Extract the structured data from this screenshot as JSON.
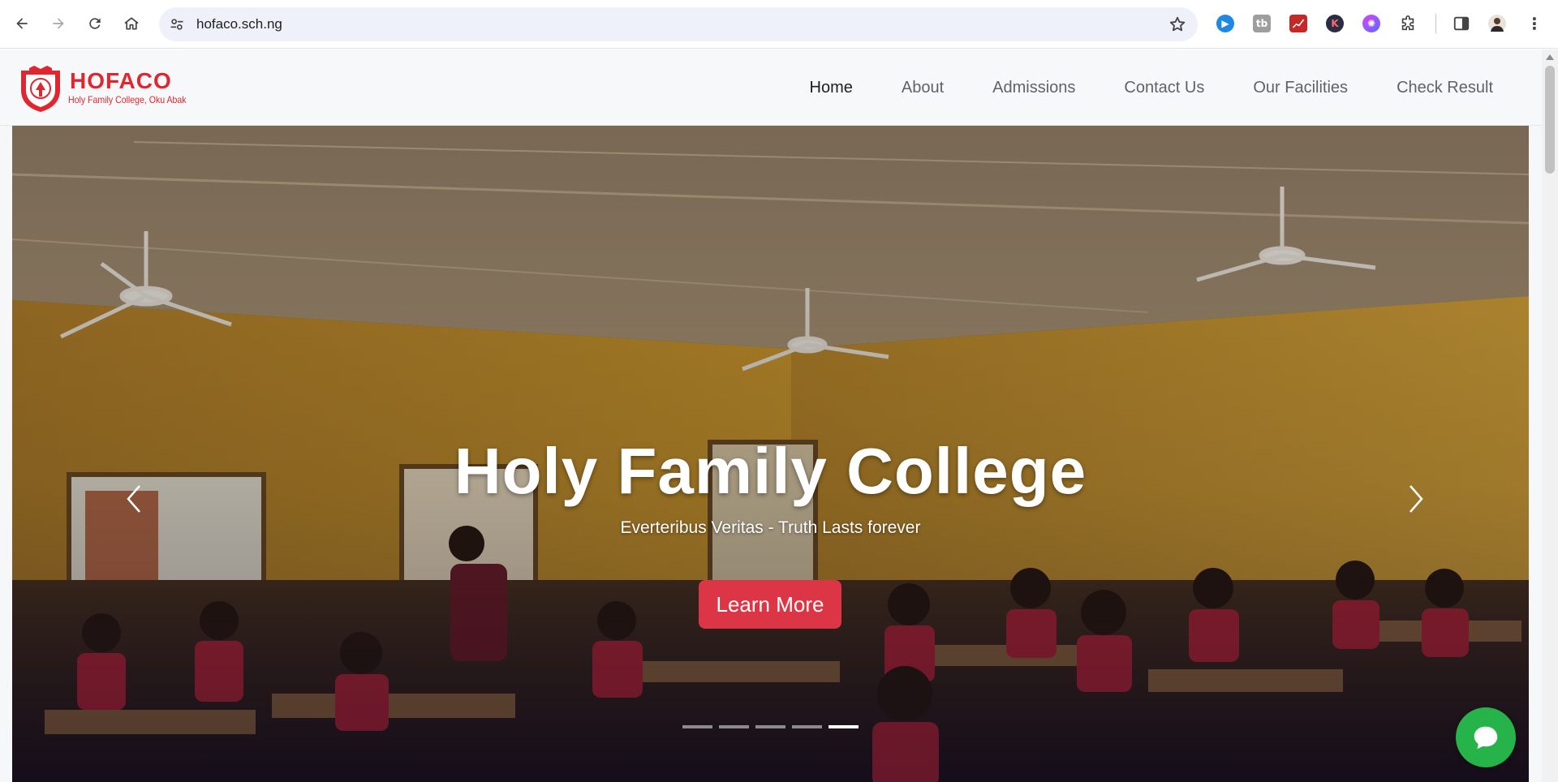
{
  "browser": {
    "url": "hofaco.sch.ng",
    "extensions": [
      "video-ext-icon",
      "tb-ext-icon",
      "chart-ext-icon",
      "k-ext-icon",
      "brain-ext-icon",
      "puzzle-icon"
    ]
  },
  "site": {
    "logo": {
      "title": "HOFACO",
      "subtitle": "Holy Family College, Oku Abak"
    },
    "nav": [
      {
        "label": "Home",
        "active": true
      },
      {
        "label": "About",
        "active": false
      },
      {
        "label": "Admissions",
        "active": false
      },
      {
        "label": "Contact Us",
        "active": false
      },
      {
        "label": "Our Facilities",
        "active": false
      },
      {
        "label": "Check Result",
        "active": false
      }
    ]
  },
  "hero": {
    "title": "Holy Family College",
    "subtitle": "Everteribus Veritas - Truth Lasts forever",
    "button_label": "Learn More",
    "slide_count": 5,
    "active_slide": 5
  },
  "colors": {
    "brand_red": "#e0262e",
    "button_red": "#dc3545",
    "chat_green": "#25b34a",
    "wall_ochre": "#c9962e"
  }
}
